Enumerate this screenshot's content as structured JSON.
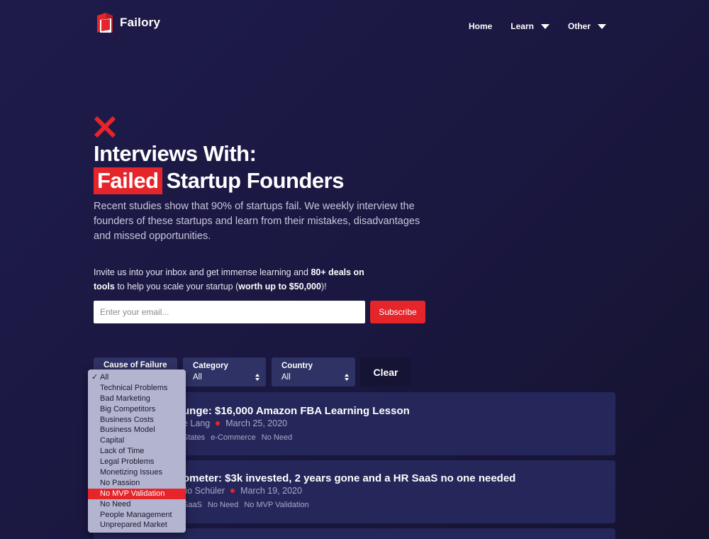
{
  "brand": {
    "name": "Failory",
    "accent": "#e5252a"
  },
  "nav": {
    "items": [
      {
        "label": "Home"
      },
      {
        "label": "Learn"
      },
      {
        "label": "Other"
      }
    ]
  },
  "hero": {
    "title_line1": "Interviews With:",
    "title_highlight": "Failed",
    "title_line2_rest": "Startup Founders",
    "description": "Recent studies show that 90% of startups fail. We weekly interview the founders of these startups and learn from their mistakes, disadvantages and missed opportunities."
  },
  "newsletter": {
    "invite_part1": "Invite us into your inbox and get immense learning and ",
    "invite_bold1": "80+ deals on tools",
    "invite_part2": " to help you scale your startup (",
    "invite_bold2": "worth up to $50,000",
    "invite_part3": ")!",
    "email_placeholder": "Enter your email...",
    "subscribe_label": "Subscribe"
  },
  "filters": {
    "cause": {
      "label": "Cause of Failure",
      "value": "All"
    },
    "category": {
      "label": "Category",
      "value": "All"
    },
    "country": {
      "label": "Country",
      "value": "All"
    },
    "clear_label": "Clear"
  },
  "dropdown": {
    "options": [
      "All",
      "Technical Problems",
      "Bad Marketing",
      "Big Competitors",
      "Business Costs",
      "Business Model",
      "Capital",
      "Lack of Time",
      "Legal Problems",
      "Monetizing Issues",
      "No Passion",
      "No MVP Validation",
      "No Need",
      "People Management",
      "Unprepared Market"
    ],
    "checked": "All",
    "highlighted": "No MVP Validation"
  },
  "interviews": [
    {
      "title_visible": "unge: $16,000 Amazon FBA Learning Lesson",
      "author_visible": "e Lang",
      "date": "March 25, 2020",
      "tags_visible": [
        "States",
        "e-Commerce",
        "No Need"
      ]
    },
    {
      "title_visible": "ometer: $3k invested, 2 years gone and a HR SaaS no one needed",
      "author_visible": "tio Schüler",
      "date": "March 19, 2020",
      "tags_visible": [
        "SaaS",
        "No Need",
        "No MVP Validation"
      ]
    }
  ]
}
